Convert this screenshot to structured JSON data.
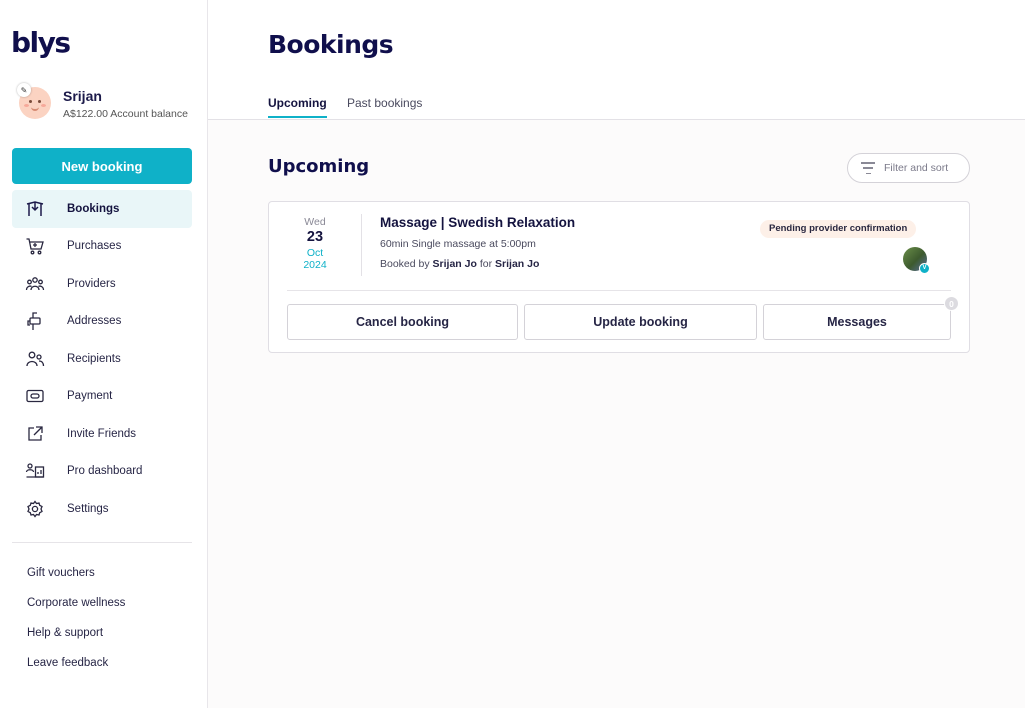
{
  "brand": {
    "logo_text": "blys",
    "accent": "#0fb1c8",
    "ink": "#100f4c"
  },
  "user": {
    "name": "Srijan",
    "balance": "A$122.00 Account balance"
  },
  "sidebar": {
    "new_booking_label": "New booking",
    "items": [
      {
        "label": "Bookings",
        "icon": "bookings-icon",
        "active": true
      },
      {
        "label": "Purchases",
        "icon": "cart-icon"
      },
      {
        "label": "Providers",
        "icon": "providers-icon"
      },
      {
        "label": "Addresses",
        "icon": "mailbox-icon"
      },
      {
        "label": "Recipients",
        "icon": "recipients-icon"
      },
      {
        "label": "Payment",
        "icon": "payment-icon"
      },
      {
        "label": "Invite Friends",
        "icon": "share-icon"
      },
      {
        "label": "Pro dashboard",
        "icon": "pro-dashboard-icon"
      },
      {
        "label": "Settings",
        "icon": "gear-icon"
      }
    ],
    "footer_links": [
      "Gift vouchers",
      "Corporate wellness",
      "Help & support",
      "Leave feedback"
    ]
  },
  "page": {
    "title": "Bookings",
    "tabs": [
      {
        "label": "Upcoming",
        "active": true
      },
      {
        "label": "Past bookings",
        "active": false
      }
    ],
    "section_title": "Upcoming",
    "filter_label": "Filter and sort"
  },
  "booking": {
    "date": {
      "dow": "Wed",
      "day": "23",
      "month": "Oct",
      "year": "2024"
    },
    "title": "Massage | Swedish Relaxation",
    "detail": "60min Single massage at 5:00pm",
    "booked_by_prefix": "Booked by",
    "booked_by": "Srijan Jo",
    "for_word": "for",
    "recipient": "Srijan Jo",
    "status": "Pending provider confirmation",
    "status_color": "#fdf0e8",
    "verified_mark": "V",
    "actions": {
      "cancel": "Cancel booking",
      "update": "Update booking",
      "messages": "Messages",
      "message_count": "0"
    }
  }
}
